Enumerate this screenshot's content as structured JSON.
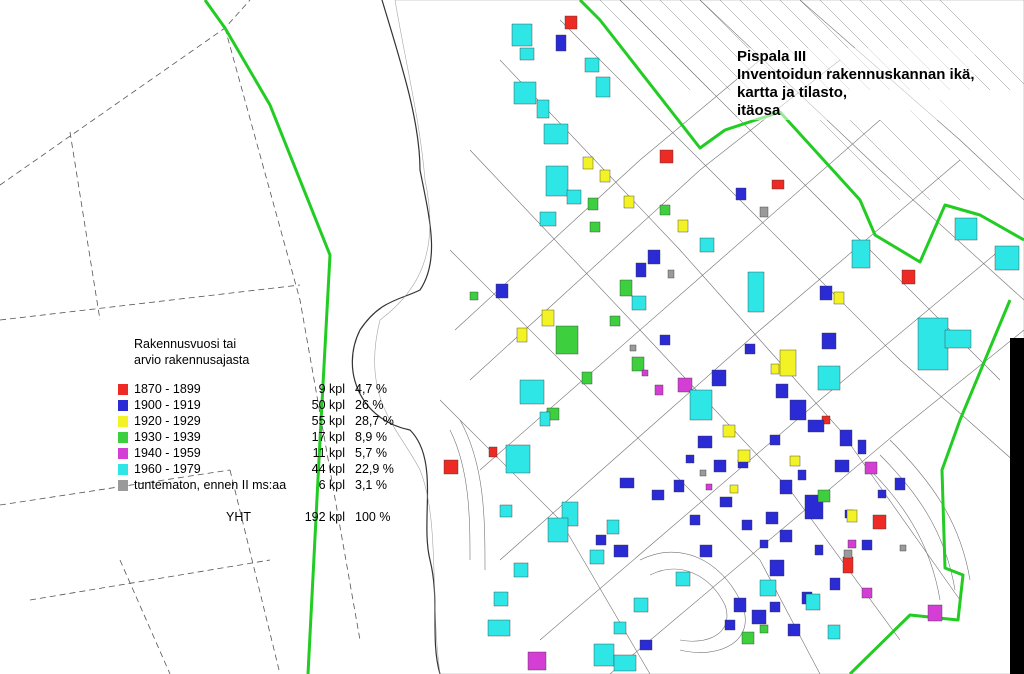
{
  "map": {
    "title_lines": [
      "Pispala III",
      "Inventoidun rakennuskannan ikä,",
      "kartta ja tilasto,",
      "itäosa"
    ],
    "legend": {
      "heading_lines": [
        "Rakennusvuosi tai",
        "arvio rakennusajasta"
      ],
      "items": [
        {
          "label": "1870 - 1899",
          "count": "9 kpl",
          "percent": "4,7 %",
          "color": "#ee2a24"
        },
        {
          "label": "1900 - 1919",
          "count": "50 kpl",
          "percent": "26 %",
          "color": "#2b2bd6"
        },
        {
          "label": "1920 - 1929",
          "count": "55 kpl",
          "percent": "28,7 %",
          "color": "#f2f224"
        },
        {
          "label": "1930 - 1939",
          "count": "17 kpl",
          "percent": "8,9 %",
          "color": "#3ecf3e"
        },
        {
          "label": "1940 - 1959",
          "count": "11 kpl",
          "percent": "5,7 %",
          "color": "#d43ed4"
        },
        {
          "label": "1960 - 1979",
          "count": "44 kpl",
          "percent": "22,9 %",
          "color": "#2ee6e6"
        },
        {
          "label": "tuntematon, ennen II ms:aa",
          "count": "6 kpl",
          "percent": "3,1 %",
          "color": "#9a9a9a"
        }
      ],
      "total": {
        "label": "YHT",
        "count": "192 kpl",
        "percent": "100 %"
      }
    },
    "boundary_color": "#22cc22"
  }
}
